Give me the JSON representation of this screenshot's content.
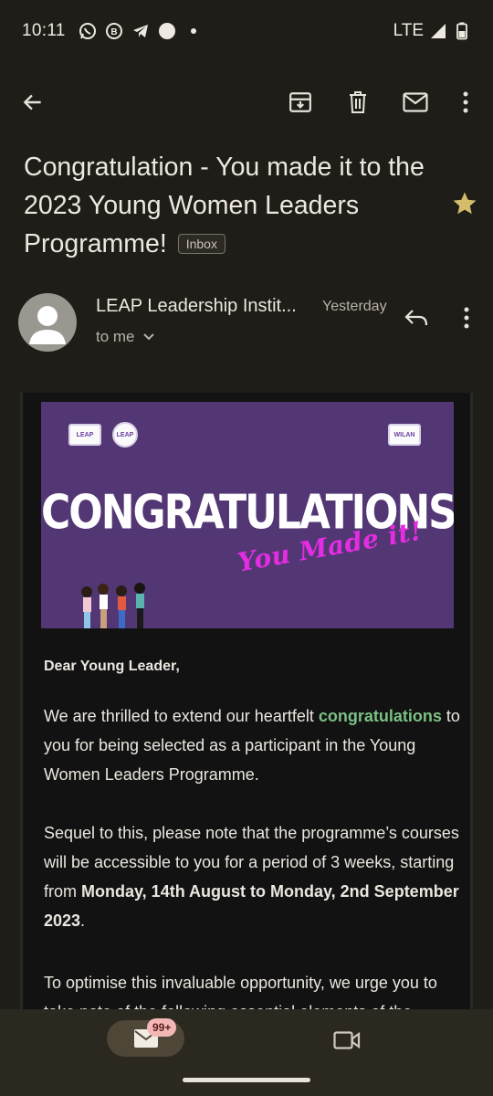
{
  "status_bar": {
    "time": "10:11",
    "network": "LTE",
    "notification_icons": [
      "whatsapp-icon",
      "whatsapp-business-icon",
      "telegram-icon",
      "circle-icon",
      "dot-icon"
    ]
  },
  "toolbar": {
    "icons": [
      "back-arrow-icon",
      "archive-icon",
      "delete-icon",
      "mark-unread-icon",
      "more-vert-icon"
    ]
  },
  "email": {
    "subject": "Congratulation - You made it to the 2023 Young Women Leaders Programme!",
    "label": "Inbox",
    "starred": true,
    "sender": "LEAP Leadership Instit...",
    "date": "Yesterday",
    "recipient": "to me",
    "banner": {
      "logo_left_1": "LEAP",
      "logo_left_2": "LEAP",
      "logo_right": "WILAN",
      "headline": "CONGRATULATIONS",
      "tagline": "You Made it!"
    },
    "greeting": "Dear Young Leader,",
    "p1_before": "We are thrilled to extend our heartfelt ",
    "p1_highlight": "congratulations",
    "p1_after": " to you for being selected as a participant in the Young Women Leaders Programme.",
    "p2_before": "Sequel to this, please note that the programme’s courses will be accessible to you for a period of 3 weeks, starting from ",
    "p2_bold": "Monday, 14th August to Monday, 2nd September 2023",
    "p2_after": ".",
    "p3": "To optimise this invaluable opportunity, we urge you to take note of the following essential elements of the"
  },
  "bottom_nav": {
    "mail_badge": "99+"
  },
  "colors": {
    "background": "#1f1d18",
    "banner_purple": "#533775",
    "highlight_green": "#7bc084",
    "star_gold": "#d4bd6a",
    "tagline_magenta": "#e52ce3"
  }
}
